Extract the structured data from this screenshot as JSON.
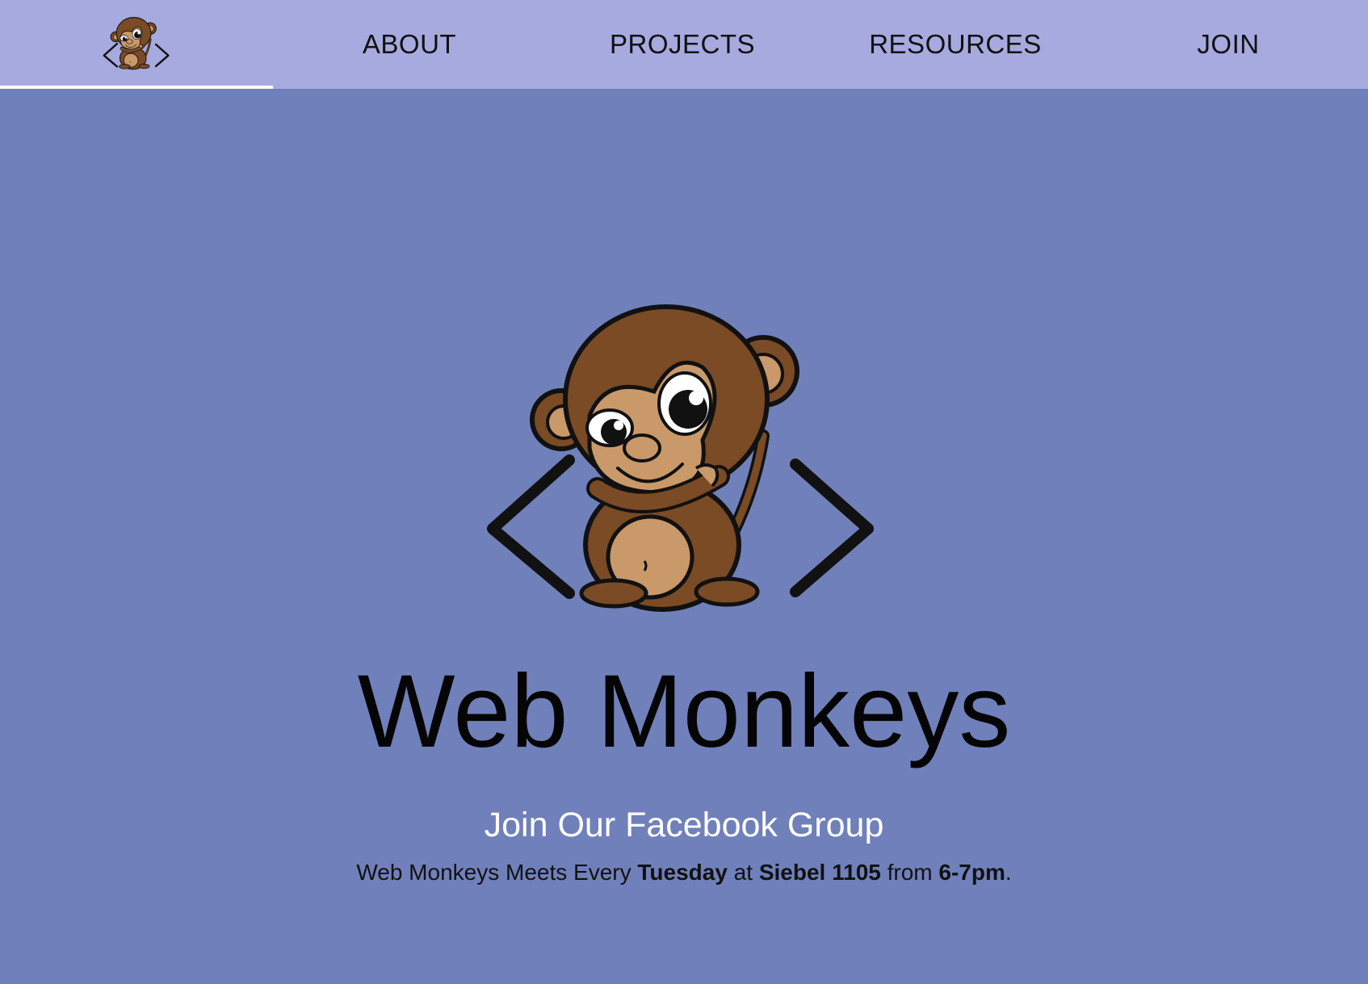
{
  "nav": {
    "logo_icon": "monkey-logo-icon",
    "items": [
      {
        "label": "ABOUT"
      },
      {
        "label": "PROJECTS"
      },
      {
        "label": "RESOURCES"
      },
      {
        "label": "JOIN"
      }
    ],
    "active_underline_color": "#ffffff",
    "background": "#a7aade"
  },
  "hero": {
    "logo_icon": "monkey-code-brackets-logo",
    "title": "Web Monkeys",
    "facebook_link": "Join Our Facebook Group",
    "meeting": {
      "prefix": "Web Monkeys Meets Every ",
      "day": "Tuesday",
      "at": " at ",
      "location": "Siebel 1105",
      "from": " from ",
      "time": "6-7pm",
      "suffix": "."
    },
    "background": "#7080ba"
  }
}
